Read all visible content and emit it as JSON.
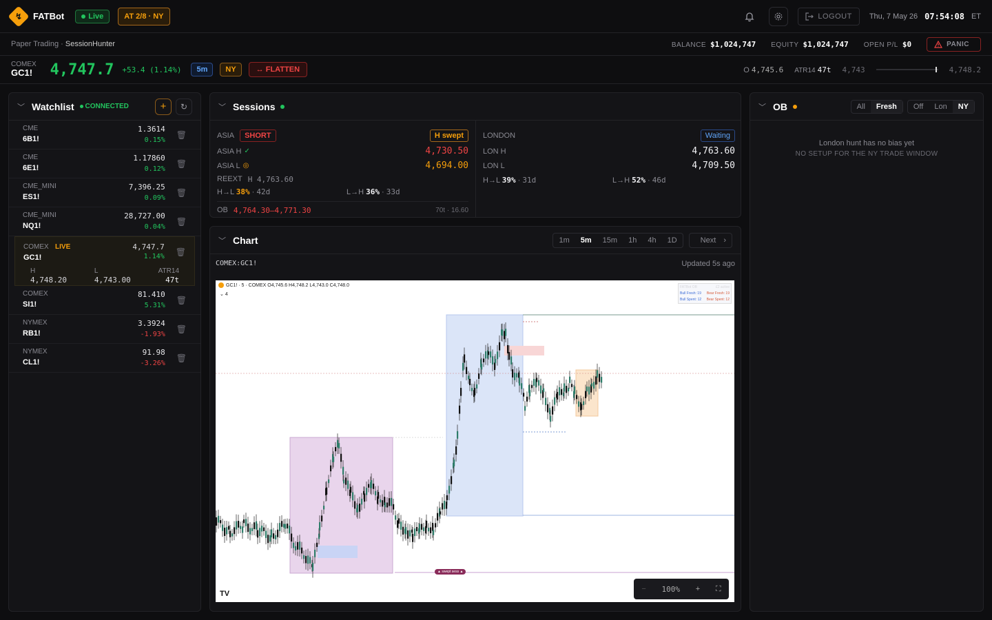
{
  "app": {
    "name": "FATBot",
    "logo_glyph": "↯",
    "live_label": "Live",
    "session_tag": "AT 2/8 · NY"
  },
  "header": {
    "logout_label": "LOGOUT",
    "date": "Thu, 7 May 26",
    "time": "07:54:08",
    "tz": "ET"
  },
  "subbar": {
    "mode": "Paper Trading",
    "separator": " · ",
    "strategy": "SessionHunter",
    "balance_label": "BALANCE",
    "balance": "$1,024,747",
    "equity_label": "EQUITY",
    "equity": "$1,024,747",
    "openpl_label": "OPEN P/L",
    "openpl": "$0",
    "panic_label": "PANIC"
  },
  "ticker": {
    "exchange": "COMEX",
    "symbol": "GC1!",
    "price": "4,747.7",
    "change": "+53.4 (1.14%)",
    "timeframe": "5m",
    "session": "NY",
    "flatten_label": "FLATTEN",
    "open_label": "O",
    "open": "4,745.6",
    "atr_label": "ATR14",
    "atr": "47t",
    "range_low": "4,743",
    "range_high": "4,748.2",
    "range_position": 0.96
  },
  "watchlist": {
    "title": "Watchlist",
    "status": "CONNECTED",
    "items": [
      {
        "exchange": "CME",
        "symbol": "6B1!",
        "price": "1.3614",
        "change": "0.15%",
        "dir": "up"
      },
      {
        "exchange": "CME",
        "symbol": "6E1!",
        "price": "1.17860",
        "change": "0.12%",
        "dir": "up"
      },
      {
        "exchange": "CME_MINI",
        "symbol": "ES1!",
        "price": "7,396.25",
        "change": "0.09%",
        "dir": "up"
      },
      {
        "exchange": "CME_MINI",
        "symbol": "NQ1!",
        "price": "28,727.00",
        "change": "0.04%",
        "dir": "up"
      }
    ],
    "active": {
      "exchange": "COMEX",
      "live": "LIVE",
      "symbol": "GC1!",
      "price": "4,747.7",
      "change": "1.14%",
      "h_label": "H",
      "h": "4,748.20",
      "l_label": "L",
      "l": "4,743.00",
      "atr_label": "ATR14",
      "atr": "47t"
    },
    "items2": [
      {
        "exchange": "COMEX",
        "symbol": "SI1!",
        "price": "81.410",
        "change": "5.31%",
        "dir": "up"
      },
      {
        "exchange": "NYMEX",
        "symbol": "RB1!",
        "price": "3.3924",
        "change": "-1.93%",
        "dir": "down"
      },
      {
        "exchange": "NYMEX",
        "symbol": "CL1!",
        "price": "91.98",
        "change": "-3.26%",
        "dir": "down"
      }
    ]
  },
  "sessions": {
    "title": "Sessions",
    "asia": {
      "label": "ASIA",
      "bias": "SHORT",
      "status": "H swept",
      "h_label": "ASIA H",
      "h": "4,730.50",
      "l_label": "ASIA L",
      "l": "4,694.00",
      "reext_label": "REEXT",
      "reext": "H 4,763.60",
      "hl_label": "H→L",
      "hl_pct": "38%",
      "hl_days": "42d",
      "lh_label": "L→H",
      "lh_pct": "36%",
      "lh_days": "33d",
      "ob_label": "OB",
      "ob_range": "4,764.30–4,771.30",
      "ob_meta": "70t · 16.60"
    },
    "london": {
      "label": "LONDON",
      "status": "Waiting",
      "h_label": "LON H",
      "h": "4,763.60",
      "l_label": "LON L",
      "l": "4,709.50",
      "hl_label": "H→L",
      "hl_pct": "39%",
      "hl_days": "31d",
      "lh_label": "L→H",
      "lh_pct": "52%",
      "lh_days": "46d"
    }
  },
  "chart": {
    "title": "Chart",
    "timeframes": [
      "1m",
      "5m",
      "15m",
      "1h",
      "4h",
      "1D"
    ],
    "active_tf": "5m",
    "next_label": "Next",
    "symbol": "COMEX:GC1!",
    "updated": "Updated 5s ago",
    "legend": "GC1! · 5 · COMEX  O4,745.6 H4,748.2 L4,743.0 C4,748.0",
    "legend_sub": "4",
    "ob_box_title": "FATBot OB",
    "ob_box_active": "£2 active",
    "ob_box_rows": [
      "Bull Fresh: 19",
      "Bear Fresh: 19",
      "Bull Spent: 12",
      "Bear Spent: 12"
    ],
    "marker_label": "▲ swept sess ▲",
    "zoom": "100%"
  },
  "ob": {
    "title": "OB",
    "filters1": [
      "All",
      "Fresh"
    ],
    "filters2": [
      "Off",
      "Lon",
      "NY"
    ],
    "active1": "Fresh",
    "active2": "NY",
    "message": "London hunt has no bias yet",
    "sub": "NO SETUP FOR THE NY TRADE WINDOW"
  },
  "colors": {
    "green": "#22c55e",
    "red": "#ef4444",
    "amber": "#f59e0b",
    "blue": "#60a5fa"
  }
}
